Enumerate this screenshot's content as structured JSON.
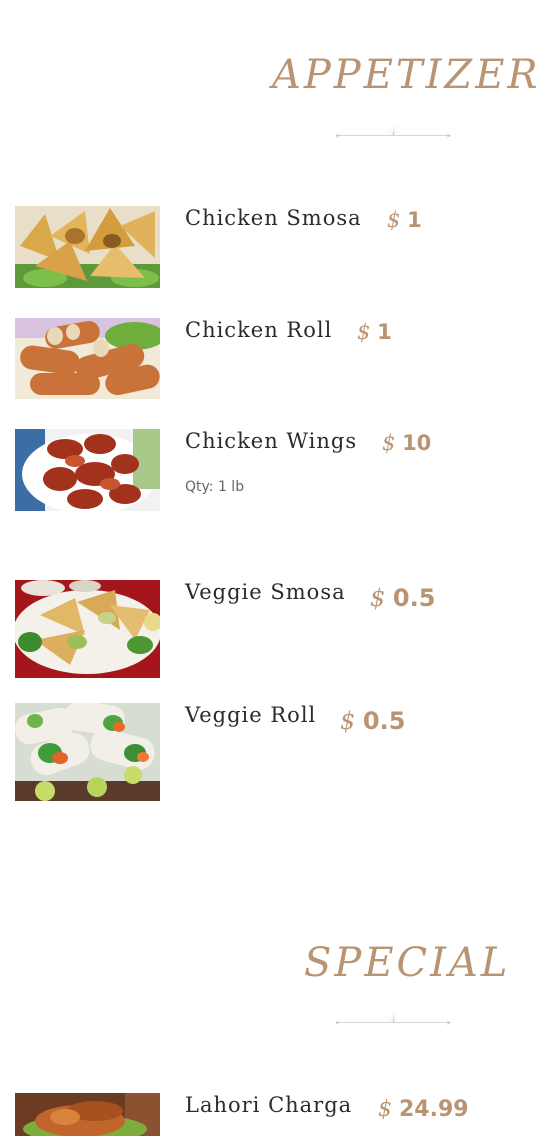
{
  "sections": [
    {
      "title": "APPETIZER",
      "items": [
        {
          "name": "Chicken Smosa",
          "currency": "$",
          "price": "1",
          "image": "samosa-photo"
        },
        {
          "name": "Chicken Roll",
          "currency": "$",
          "price": "1",
          "image": "spring-roll-photo"
        },
        {
          "name": "Chicken Wings",
          "currency": "$",
          "price": "10",
          "qty": "Qty: 1 lb",
          "image": "chicken-wings-photo"
        },
        {
          "name": "Veggie Smosa",
          "currency": "$",
          "price": "0.5",
          "image": "veggie-samosa-photo"
        },
        {
          "name": "Veggie Roll",
          "currency": "$",
          "price": "0.5",
          "image": "veggie-roll-photo"
        }
      ]
    },
    {
      "title": "SPECIAL",
      "items": [
        {
          "name": "Lahori Charga",
          "currency": "$",
          "price": "24.99",
          "image": "charga-chicken-photo"
        }
      ]
    }
  ],
  "colors": {
    "accent": "#b99472",
    "text": "#2b2b2b",
    "muted": "#666666",
    "divider": "#bdbdbd"
  }
}
